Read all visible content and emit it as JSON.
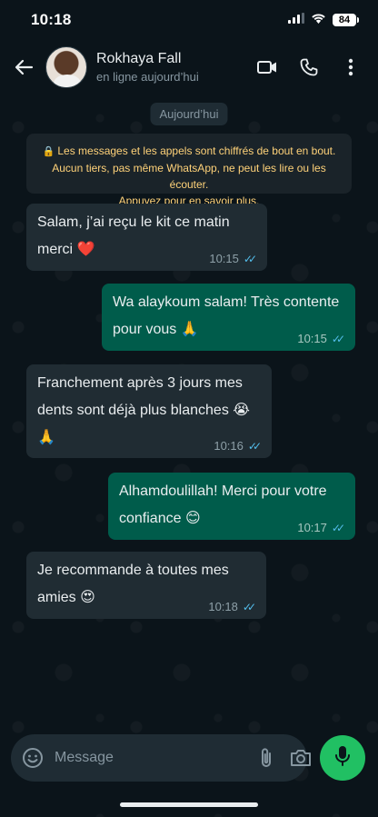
{
  "status_bar": {
    "time": "10:18",
    "battery": "84"
  },
  "header": {
    "contact_name": "Rokhaya Fall",
    "contact_status": "en ligne aujourd’hui"
  },
  "chat": {
    "date_chip": "Aujourd’hui",
    "encryption_line1": "Les messages et les appels sont chiffrés de bout en bout.",
    "encryption_line2": "Aucun tiers, pas même WhatsApp, ne peut les lire ou les écouter.",
    "encryption_line3": "Appuyez pour en savoir plus.",
    "messages": [
      {
        "direction": "in",
        "line1": "Salam, j’ai reçu le kit ce matin",
        "line2": "merci ❤️",
        "time": "10:15"
      },
      {
        "direction": "out",
        "line1": "Wa alaykoum salam! Très contente",
        "line2": "pour vous 🙏",
        "time": "10:15"
      },
      {
        "direction": "in",
        "line1": "Franchement après 3 jours mes",
        "line2": "dents sont déjà plus blanches 😭",
        "line3": "🙏",
        "time": "10:16"
      },
      {
        "direction": "out",
        "line1": "Alhamdoulillah! Merci pour votre",
        "line2": "confiance 😊",
        "time": "10:17"
      },
      {
        "direction": "in",
        "line1": "Je recommande à toutes mes",
        "line2": "amies 😍",
        "time": "10:18"
      }
    ]
  },
  "composer": {
    "placeholder": "Message"
  },
  "colors": {
    "background": "#0b141a",
    "incoming_bubble": "#202c33",
    "outgoing_bubble": "#005c4b",
    "read_ticks": "#53bdeb",
    "mic_button": "#21c063",
    "encryption_text": "#ffd279"
  },
  "icons": [
    "back-arrow-icon",
    "video-call-icon",
    "phone-icon",
    "more-vert-icon",
    "lock-icon",
    "emoji-icon",
    "attach-icon",
    "camera-icon",
    "mic-icon",
    "signal-icon",
    "wifi-icon",
    "battery-icon"
  ]
}
